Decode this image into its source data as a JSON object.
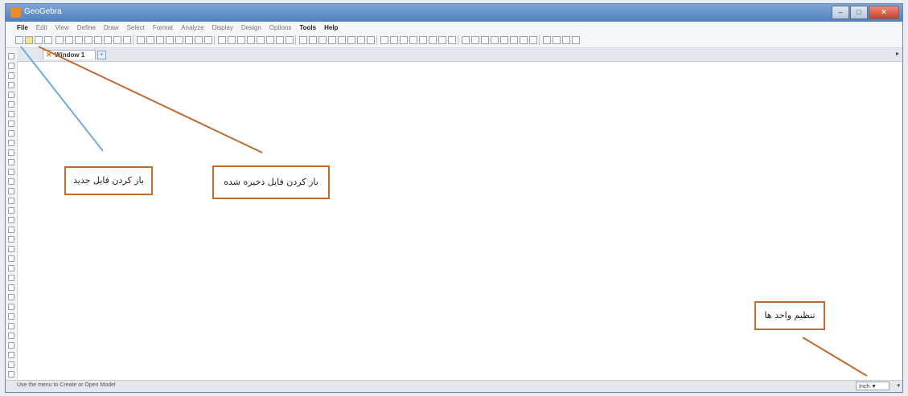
{
  "window": {
    "title": "GeoGebra"
  },
  "menu": {
    "items": [
      {
        "label": "File",
        "bold": true
      },
      {
        "label": "Edit",
        "bold": false
      },
      {
        "label": "View",
        "bold": false
      },
      {
        "label": "Define",
        "bold": false
      },
      {
        "label": "Draw",
        "bold": false
      },
      {
        "label": "Select",
        "bold": false
      },
      {
        "label": "Format",
        "bold": false
      },
      {
        "label": "Analyze",
        "bold": false
      },
      {
        "label": "Display",
        "bold": false
      },
      {
        "label": "Design",
        "bold": false
      },
      {
        "label": "Options",
        "bold": false
      },
      {
        "label": "Tools",
        "bold": true
      },
      {
        "label": "Help",
        "bold": true
      }
    ]
  },
  "tab": {
    "label": "Window 1",
    "close_glyph": "✕",
    "add_glyph": "+"
  },
  "status": {
    "text": "Use the menu to Create or Open Model",
    "unit_value": "Inch ▼"
  },
  "callouts": {
    "new_file": "باز کردن فایل جدید",
    "open_saved": "باز کردن فایل ذخیره شده",
    "units": "تنظیم واحد ها"
  },
  "colors": {
    "callout_border": "#c06b30",
    "arrow_blue": "#6aaedc",
    "arrow_orange": "#c06b30"
  }
}
